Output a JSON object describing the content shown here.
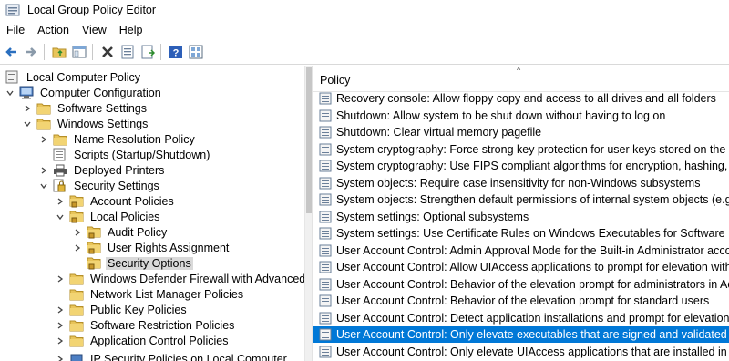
{
  "window": {
    "title": "Local Group Policy Editor"
  },
  "menu": [
    "File",
    "Action",
    "View",
    "Help"
  ],
  "toolbar": {
    "buttons": [
      "back-icon",
      "forward-icon",
      "up-folder-icon",
      "show-hide-tree-icon",
      "delete-icon",
      "properties-icon",
      "export-list-icon",
      "help-icon",
      "filter-view-icon"
    ]
  },
  "tree": {
    "items": [
      {
        "label": "Local Computer Policy"
      },
      {
        "label": "Computer Configuration"
      },
      {
        "label": "Software Settings"
      },
      {
        "label": "Windows Settings"
      },
      {
        "label": "Name Resolution Policy"
      },
      {
        "label": "Scripts (Startup/Shutdown)"
      },
      {
        "label": "Deployed Printers"
      },
      {
        "label": "Security Settings"
      },
      {
        "label": "Account Policies"
      },
      {
        "label": "Local Policies"
      },
      {
        "label": "Audit Policy"
      },
      {
        "label": "User Rights Assignment"
      },
      {
        "label": "Security Options"
      },
      {
        "label": "Windows Defender Firewall with Advanced S"
      },
      {
        "label": "Network List Manager Policies"
      },
      {
        "label": "Public Key Policies"
      },
      {
        "label": "Software Restriction Policies"
      },
      {
        "label": "Application Control Policies"
      },
      {
        "label": "IP Security Policies on Local Computer"
      }
    ]
  },
  "list": {
    "header": "Policy",
    "rows": [
      {
        "label": "Recovery console: Allow floppy copy and access to all drives and all folders"
      },
      {
        "label": "Shutdown: Allow system to be shut down without having to log on"
      },
      {
        "label": "Shutdown: Clear virtual memory pagefile"
      },
      {
        "label": "System cryptography: Force strong key protection for user keys stored on the com..."
      },
      {
        "label": "System cryptography: Use FIPS compliant algorithms for encryption, hashing, and ..."
      },
      {
        "label": "System objects: Require case insensitivity for non-Windows subsystems"
      },
      {
        "label": "System objects: Strengthen default permissions of internal system objects (e.g. Sy..."
      },
      {
        "label": "System settings: Optional subsystems"
      },
      {
        "label": "System settings: Use Certificate Rules on Windows Executables for Software Restric..."
      },
      {
        "label": "User Account Control: Admin Approval Mode for the Built-in Administrator account"
      },
      {
        "label": "User Account Control: Allow UIAccess applications to prompt for elevation withou..."
      },
      {
        "label": "User Account Control: Behavior of the elevation prompt for administrators in Adm..."
      },
      {
        "label": "User Account Control: Behavior of the elevation prompt for standard users"
      },
      {
        "label": "User Account Control: Detect application installations and prompt for elevation"
      },
      {
        "label": "User Account Control: Only elevate executables that are signed and validated"
      },
      {
        "label": "User Account Control: Only elevate UIAccess applications that are installed in secu..."
      }
    ],
    "selected_index": 14
  },
  "colors": {
    "selection": "#0078d7",
    "tree_selection": "#d9d9d9",
    "folder": "#e8c45a"
  }
}
